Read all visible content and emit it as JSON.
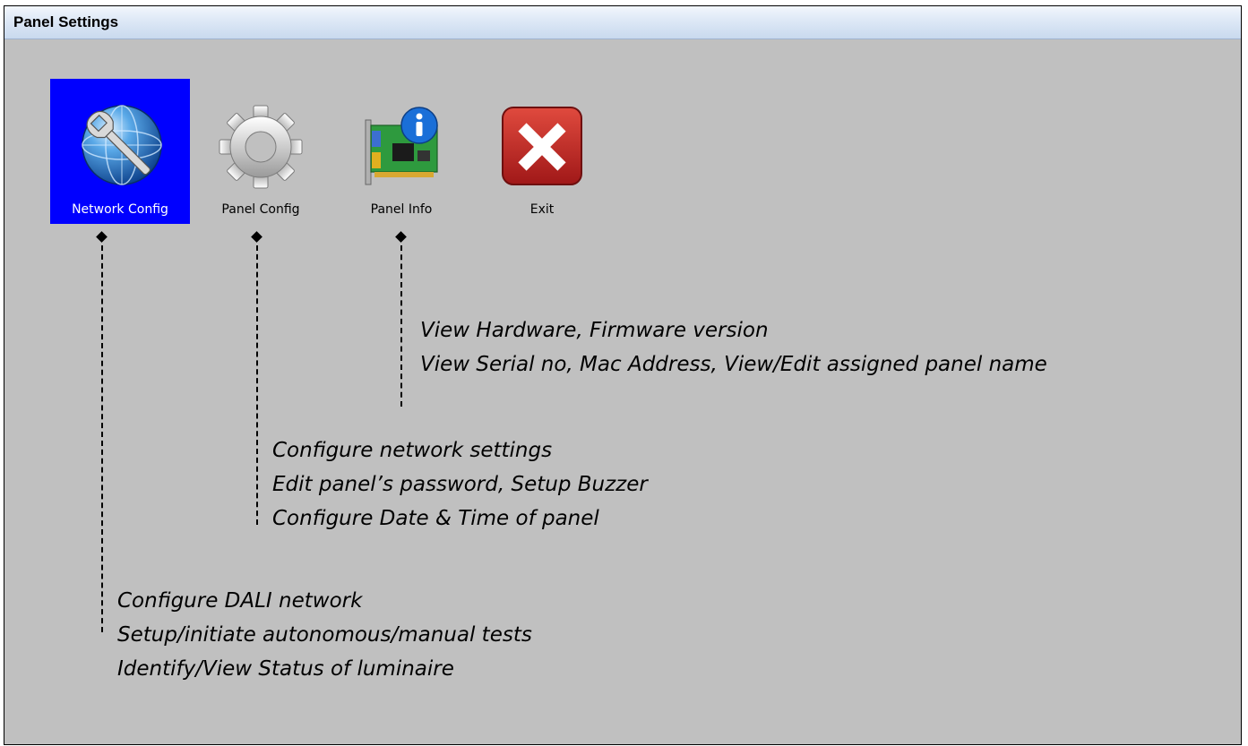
{
  "window": {
    "title": "Panel Settings"
  },
  "toolbar": {
    "items": [
      {
        "label": "Network Config",
        "icon": "network-config-icon",
        "selected": true
      },
      {
        "label": "Panel Config",
        "icon": "gear-icon",
        "selected": false
      },
      {
        "label": "Panel Info",
        "icon": "panel-info-icon",
        "selected": false
      },
      {
        "label": "Exit",
        "icon": "exit-icon",
        "selected": false
      }
    ]
  },
  "annotations": {
    "panel_info": [
      "View Hardware, Firmware version",
      "View Serial no, Mac Address, View/Edit assigned panel name"
    ],
    "panel_config": [
      "Configure network settings",
      "Edit panel’s password, Setup Buzzer",
      "Configure Date & Time of panel"
    ],
    "network_config": [
      "Configure DALI network",
      "Setup/initiate autonomous/manual tests",
      "Identify/View Status of luminaire"
    ]
  },
  "colors": {
    "selection": "#0000ff",
    "panel_background": "#c0c0c0",
    "exit_red": "#c0262a"
  }
}
